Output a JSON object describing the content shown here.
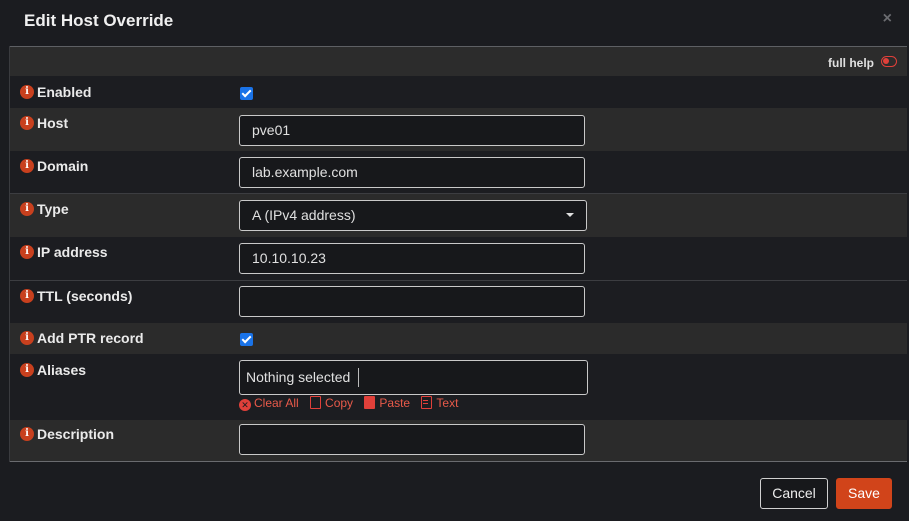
{
  "dialog": {
    "title": "Edit Host Override",
    "close_glyph": "×"
  },
  "help": {
    "label": "full help",
    "toggle_icon": "toggle-off-icon"
  },
  "info_glyph": "i",
  "fields": {
    "enabled": {
      "label": "Enabled",
      "checked": true
    },
    "host": {
      "label": "Host",
      "value": "pve01"
    },
    "domain": {
      "label": "Domain",
      "value": "lab.example.com"
    },
    "type": {
      "label": "Type",
      "value": "A (IPv4 address)"
    },
    "ip_address": {
      "label": "IP address",
      "value": "10.10.10.23"
    },
    "ttl": {
      "label": "TTL (seconds)",
      "value": ""
    },
    "add_ptr": {
      "label": "Add PTR record",
      "checked": true
    },
    "aliases": {
      "label": "Aliases",
      "placeholder": "Nothing selected",
      "actions": {
        "clear_all": "Clear All",
        "copy": "Copy",
        "paste": "Paste",
        "text": "Text"
      }
    },
    "description": {
      "label": "Description",
      "value": ""
    }
  },
  "buttons": {
    "cancel": "Cancel",
    "save": "Save"
  },
  "colors": {
    "accent": "#d1441a",
    "checkbox": "#1a73e8",
    "link": "#e85a4a"
  }
}
